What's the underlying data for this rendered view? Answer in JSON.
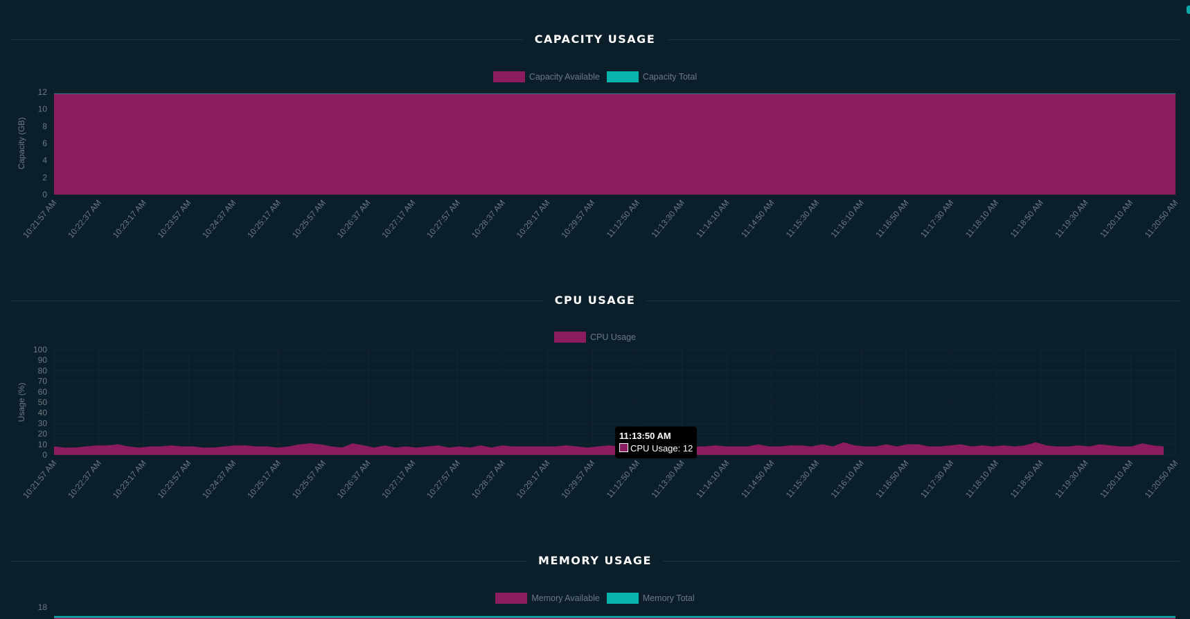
{
  "colors": {
    "background": "#0b1f2a",
    "primary_fill": "#8b1c5f",
    "secondary_fill": "#06b3ad",
    "axis_text": "#6b7a83",
    "grid": "#13262f"
  },
  "capacity": {
    "title": "CAPACITY USAGE",
    "legend": [
      {
        "label": "Capacity Available",
        "color": "#8b1c5f"
      },
      {
        "label": "Capacity Total",
        "color": "#06b3ad"
      }
    ]
  },
  "cpu": {
    "title": "CPU USAGE",
    "legend": [
      {
        "label": "CPU Usage",
        "color": "#8b1c5f"
      }
    ],
    "tooltip": {
      "title": "11:13:50 AM",
      "body": "CPU Usage: 12"
    }
  },
  "memory": {
    "title": "MEMORY USAGE",
    "legend": [
      {
        "label": "Memory Available",
        "color": "#8b1c5f"
      },
      {
        "label": "Memory Total",
        "color": "#06b3ad"
      }
    ]
  },
  "chart_data": [
    {
      "type": "area",
      "title": "CAPACITY USAGE",
      "ylabel": "Capacity (GB)",
      "ylim": [
        0,
        12
      ],
      "yticks": [
        0,
        2,
        4,
        6,
        8,
        10,
        12
      ],
      "grid": true,
      "legend_position": "top",
      "x": [
        "10:21:57 AM",
        "10:22:37 AM",
        "10:23:17 AM",
        "10:23:57 AM",
        "10:24:37 AM",
        "10:25:17 AM",
        "10:25:57 AM",
        "10:26:37 AM",
        "10:27:17 AM",
        "10:27:57 AM",
        "10:28:37 AM",
        "10:29:17 AM",
        "10:29:57 AM",
        "11:12:50 AM",
        "11:13:30 AM",
        "11:14:10 AM",
        "11:14:50 AM",
        "11:15:30 AM",
        "11:16:10 AM",
        "11:16:50 AM",
        "11:17:30 AM",
        "11:18:10 AM",
        "11:18:50 AM",
        "11:19:30 AM",
        "11:20:10 AM",
        "11:20:50 AM"
      ],
      "series": [
        {
          "name": "Capacity Available",
          "values": [
            11.8,
            11.8,
            11.8,
            11.8,
            11.8,
            11.8,
            11.8,
            11.8,
            11.8,
            11.8,
            11.8,
            11.8,
            11.8,
            11.8,
            11.8,
            11.8,
            11.8,
            11.8,
            11.8,
            11.8,
            11.8,
            11.8,
            11.8,
            11.8,
            11.8,
            11.8
          ]
        },
        {
          "name": "Capacity Total",
          "values": [
            11.8,
            11.8,
            11.8,
            11.8,
            11.8,
            11.8,
            11.8,
            11.8,
            11.8,
            11.8,
            11.8,
            11.8,
            11.8,
            11.8,
            11.8,
            11.8,
            11.8,
            11.8,
            11.8,
            11.8,
            11.8,
            11.8,
            11.8,
            11.8,
            11.8,
            11.8
          ]
        }
      ]
    },
    {
      "type": "area",
      "title": "CPU USAGE",
      "ylabel": "Usage (%)",
      "ylim": [
        0,
        100
      ],
      "yticks": [
        0,
        10,
        20,
        30,
        40,
        50,
        60,
        70,
        80,
        90,
        100
      ],
      "grid": true,
      "legend_position": "top",
      "x": [
        "10:21:57 AM",
        "10:22:37 AM",
        "10:23:17 AM",
        "10:23:57 AM",
        "10:24:37 AM",
        "10:25:17 AM",
        "10:25:57 AM",
        "10:26:37 AM",
        "10:27:17 AM",
        "10:27:57 AM",
        "10:28:37 AM",
        "10:29:17 AM",
        "10:29:57 AM",
        "11:12:50 AM",
        "11:13:30 AM",
        "11:14:10 AM",
        "11:14:50 AM",
        "11:15:30 AM",
        "11:16:10 AM",
        "11:16:50 AM",
        "11:17:30 AM",
        "11:18:10 AM",
        "11:18:50 AM",
        "11:19:30 AM",
        "11:20:10 AM",
        "11:20:50 AM"
      ],
      "series": [
        {
          "name": "CPU Usage",
          "values": [
            8,
            7,
            7,
            8,
            9,
            9,
            10,
            8,
            7,
            8,
            8,
            9,
            8,
            8,
            7,
            7,
            8,
            9,
            9,
            8,
            8,
            7,
            8,
            10,
            11,
            10,
            8,
            7,
            11,
            9,
            7,
            9,
            7,
            8,
            7,
            8,
            9,
            7,
            8,
            7,
            9,
            7,
            9,
            8,
            8,
            8,
            8,
            8,
            9,
            8,
            7,
            8,
            9,
            8,
            9,
            8,
            7,
            9,
            8,
            12,
            8,
            8,
            9,
            8,
            8,
            8,
            10,
            8,
            8,
            9,
            9,
            8,
            10,
            8,
            12,
            9,
            8,
            8,
            10,
            8,
            10,
            10,
            8,
            8,
            9,
            10,
            8,
            9,
            8,
            9,
            8,
            9,
            12,
            9,
            8,
            8,
            9,
            8,
            10,
            9,
            8,
            8,
            11,
            9,
            8
          ]
        }
      ]
    },
    {
      "type": "area",
      "title": "MEMORY USAGE",
      "ylim": [
        0,
        18
      ],
      "yticks": [
        18
      ],
      "legend_position": "top",
      "series": [
        {
          "name": "Memory Available",
          "values": []
        },
        {
          "name": "Memory Total",
          "values": []
        }
      ]
    }
  ]
}
